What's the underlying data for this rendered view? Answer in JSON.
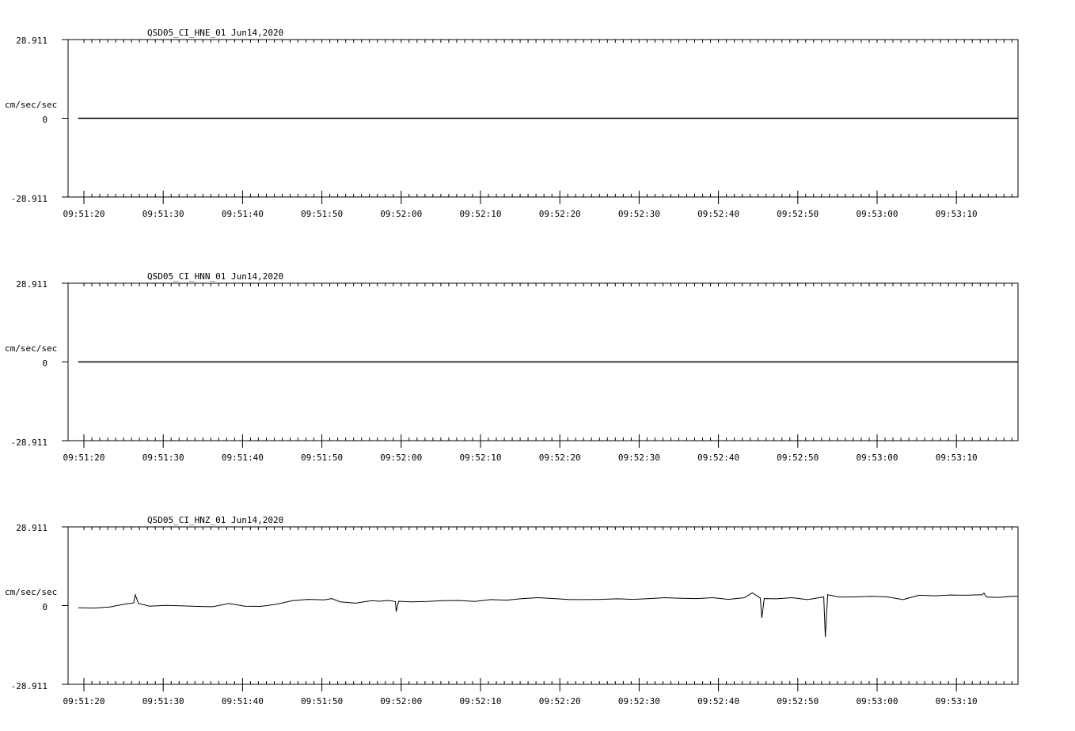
{
  "chart_data": [
    {
      "type": "line",
      "title": "QSD05_CI_HNE_01  Jun14,2020",
      "ylabel": "cm/sec/sec",
      "ylim": [
        -28.911,
        28.911
      ],
      "y_tick_labels": [
        "28.911",
        "0",
        "-28.911"
      ],
      "x_tick_labels": [
        "09:51:20",
        "09:51:30",
        "09:51:40",
        "09:51:50",
        "09:52:00",
        "09:52:10",
        "09:52:20",
        "09:52:30",
        "09:52:40",
        "09:52:50",
        "09:53:00",
        "09:53:10"
      ],
      "series": [
        {
          "x": [
            0.0,
            128.0
          ],
          "y": [
            0.0,
            0.0
          ]
        }
      ]
    },
    {
      "type": "line",
      "title": "QSD05_CI_HNN_01  Jun14,2020",
      "ylabel": "cm/sec/sec",
      "ylim": [
        -28.911,
        28.911
      ],
      "y_tick_labels": [
        "28.911",
        "0",
        "-28.911"
      ],
      "x_tick_labels": [
        "09:51:20",
        "09:51:30",
        "09:51:40",
        "09:51:50",
        "09:52:00",
        "09:52:10",
        "09:52:20",
        "09:52:30",
        "09:52:40",
        "09:52:50",
        "09:53:00",
        "09:53:10"
      ],
      "series": [
        {
          "x": [
            0.0,
            128.0
          ],
          "y": [
            0.0,
            0.0
          ]
        }
      ]
    },
    {
      "type": "line",
      "title": "QSD05_CI_HNZ_01  Jun14,2020",
      "ylabel": "cm/sec/sec",
      "ylim": [
        -28.911,
        28.911
      ],
      "y_tick_labels": [
        "28.911",
        "0",
        "-28.911"
      ],
      "x_tick_labels": [
        "09:51:20",
        "09:51:30",
        "09:51:40",
        "09:51:50",
        "09:52:00",
        "09:52:10",
        "09:52:20",
        "09:52:30",
        "09:52:40",
        "09:52:50",
        "09:53:00",
        "09:53:10"
      ],
      "series": [
        {
          "x": [
            0.0,
            2.0,
            4.0,
            6.0,
            7.0,
            7.2,
            7.6,
            9.0,
            11.0,
            13.0,
            15.0,
            17.0,
            19.0,
            21.0,
            23.0,
            25.0,
            27.0,
            29.0,
            31.0,
            32.0,
            33.0,
            35.0,
            37.0,
            38.0,
            39.0,
            40.0,
            40.1,
            40.4,
            42.0,
            44.0,
            46.0,
            48.0,
            50.0,
            52.0,
            54.0,
            56.0,
            58.0,
            60.0,
            62.0,
            64.0,
            66.0,
            68.0,
            70.0,
            72.0,
            74.0,
            76.0,
            78.0,
            80.0,
            82.0,
            84.0,
            85.0,
            86.0,
            86.2,
            86.5,
            88.0,
            90.0,
            92.0,
            94.0,
            94.2,
            94.5,
            96.0,
            98.0,
            100.0,
            102.0,
            104.0,
            106.0,
            108.0,
            110.0,
            112.0,
            114.0,
            114.2,
            114.5,
            116.0,
            118.0,
            120.0,
            122.0,
            124.0,
            126.0,
            128.0
          ],
          "y": [
            -0.8,
            -0.9,
            -0.5,
            0.6,
            1.0,
            4.0,
            0.8,
            -0.2,
            0.1,
            -0.1,
            -0.3,
            -0.4,
            0.8,
            -0.2,
            -0.3,
            0.5,
            1.8,
            2.3,
            2.1,
            2.6,
            1.4,
            0.9,
            1.8,
            1.6,
            1.9,
            1.5,
            -2.2,
            1.6,
            1.4,
            1.5,
            1.8,
            1.9,
            1.5,
            2.2,
            2.0,
            2.6,
            2.9,
            2.6,
            2.2,
            2.2,
            2.3,
            2.5,
            2.3,
            2.6,
            2.9,
            2.7,
            2.6,
            2.9,
            2.3,
            2.9,
            4.7,
            2.8,
            -4.5,
            2.6,
            2.5,
            2.9,
            2.2,
            3.2,
            -11.5,
            4.0,
            3.1,
            3.2,
            3.4,
            3.2,
            2.2,
            3.8,
            3.6,
            3.9,
            3.8,
            4.0,
            4.6,
            3.2,
            3.0,
            3.5,
            3.4,
            2.7,
            3.3,
            2.9,
            1.5
          ]
        }
      ]
    }
  ]
}
